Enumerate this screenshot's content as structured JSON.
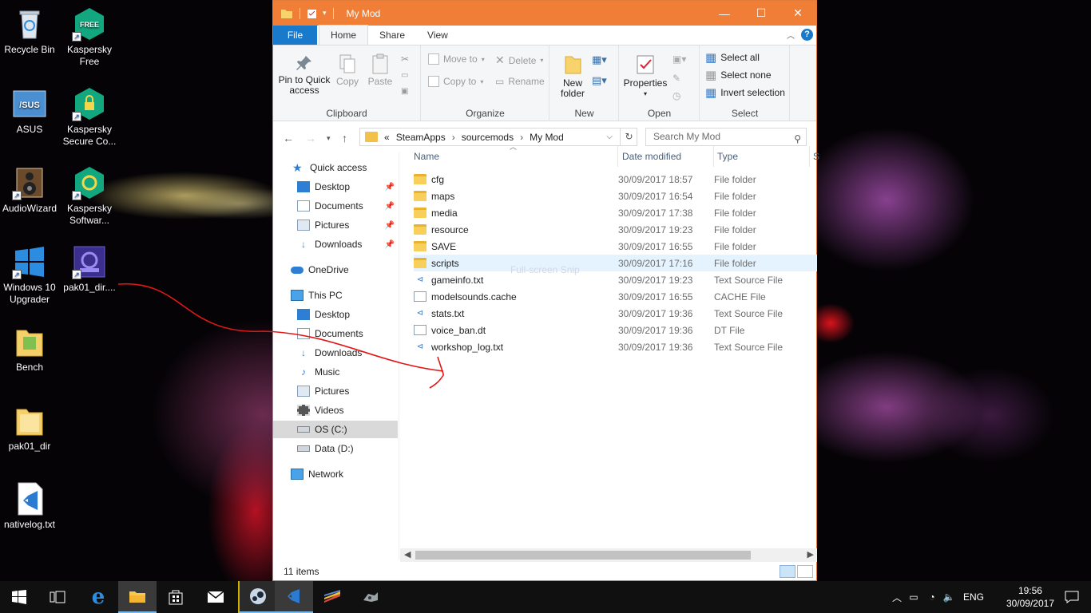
{
  "desktop": {
    "icons": [
      {
        "label": "Recycle Bin",
        "icon": "recycle-bin-icon"
      },
      {
        "label": "Kaspersky Free",
        "icon": "kaspersky-free-icon"
      },
      {
        "label": "ASUS",
        "icon": "asus-icon"
      },
      {
        "label": "Kaspersky Secure Co...",
        "icon": "kaspersky-secure-icon"
      },
      {
        "label": "AudioWizard",
        "icon": "audiowizard-icon"
      },
      {
        "label": "Kaspersky Softwar...",
        "icon": "kaspersky-software-icon"
      },
      {
        "label": "Windows 10 Upgrader",
        "icon": "windows-icon"
      },
      {
        "label": "pak01_dir....",
        "icon": "pak01-dir-shortcut-icon"
      },
      {
        "label": "Bench",
        "icon": "folder-icon"
      },
      {
        "label": "pak01_dir",
        "icon": "folder-icon"
      },
      {
        "label": "nativelog.txt",
        "icon": "vscode-icon"
      }
    ],
    "kaspersky_badge": "FREE"
  },
  "window": {
    "title": "My Mod",
    "controls": {
      "minimize": "—",
      "maximize": "☐",
      "close": "✕"
    },
    "tabs": {
      "file": "File",
      "home": "Home",
      "share": "Share",
      "view": "View"
    },
    "help": "?"
  },
  "ribbon": {
    "clipboard": {
      "label": "Clipboard",
      "pin": "Pin to Quick access",
      "copy": "Copy",
      "paste": "Paste"
    },
    "organize": {
      "label": "Organize",
      "move_to": "Move to",
      "copy_to": "Copy to",
      "delete": "Delete",
      "rename": "Rename"
    },
    "new": {
      "label": "New",
      "new_folder": "New folder"
    },
    "open": {
      "label": "Open",
      "properties": "Properties"
    },
    "select": {
      "label": "Select",
      "select_all": "Select all",
      "select_none": "Select none",
      "invert": "Invert selection"
    }
  },
  "address": {
    "overflow": "«",
    "crumbs": [
      "SteamApps",
      "sourcemods",
      "My Mod"
    ],
    "search_placeholder": "Search My Mod"
  },
  "nav": {
    "quick_access": "Quick access",
    "qa_items": [
      "Desktop",
      "Documents",
      "Pictures",
      "Downloads"
    ],
    "onedrive": "OneDrive",
    "this_pc": "This PC",
    "pc_items": [
      "Desktop",
      "Documents",
      "Downloads",
      "Music",
      "Pictures",
      "Videos",
      "OS (C:)",
      "Data (D:)"
    ],
    "network": "Network"
  },
  "columns": {
    "name": "Name",
    "date": "Date modified",
    "type": "Type",
    "size": "S"
  },
  "files": [
    {
      "name": "cfg",
      "date": "30/09/2017 18:57",
      "type": "File folder",
      "kind": "folder"
    },
    {
      "name": "maps",
      "date": "30/09/2017 16:54",
      "type": "File folder",
      "kind": "folder"
    },
    {
      "name": "media",
      "date": "30/09/2017 17:38",
      "type": "File folder",
      "kind": "folder"
    },
    {
      "name": "resource",
      "date": "30/09/2017 19:23",
      "type": "File folder",
      "kind": "folder"
    },
    {
      "name": "SAVE",
      "date": "30/09/2017 16:55",
      "type": "File folder",
      "kind": "folder"
    },
    {
      "name": "scripts",
      "date": "30/09/2017 17:16",
      "type": "File folder",
      "kind": "folder"
    },
    {
      "name": "gameinfo.txt",
      "date": "30/09/2017 19:23",
      "type": "Text Source File",
      "kind": "txt"
    },
    {
      "name": "modelsounds.cache",
      "date": "30/09/2017 16:55",
      "type": "CACHE File",
      "kind": "generic"
    },
    {
      "name": "stats.txt",
      "date": "30/09/2017 19:36",
      "type": "Text Source File",
      "kind": "txt"
    },
    {
      "name": "voice_ban.dt",
      "date": "30/09/2017 19:36",
      "type": "DT File",
      "kind": "generic"
    },
    {
      "name": "workshop_log.txt",
      "date": "30/09/2017 19:36",
      "type": "Text Source File",
      "kind": "txt"
    }
  ],
  "overlay_text": "Full-screen Snip",
  "status": {
    "count": "11 items"
  },
  "taskbar": {
    "language": "ENG",
    "time": "19:56",
    "date": "30/09/2017",
    "apps": [
      "start-icon",
      "task-view-icon",
      "edge-icon",
      "file-explorer-icon",
      "store-icon",
      "mail-icon",
      "steam-icon",
      "vscode-icon",
      "winrar-icon",
      "game-icon"
    ]
  }
}
